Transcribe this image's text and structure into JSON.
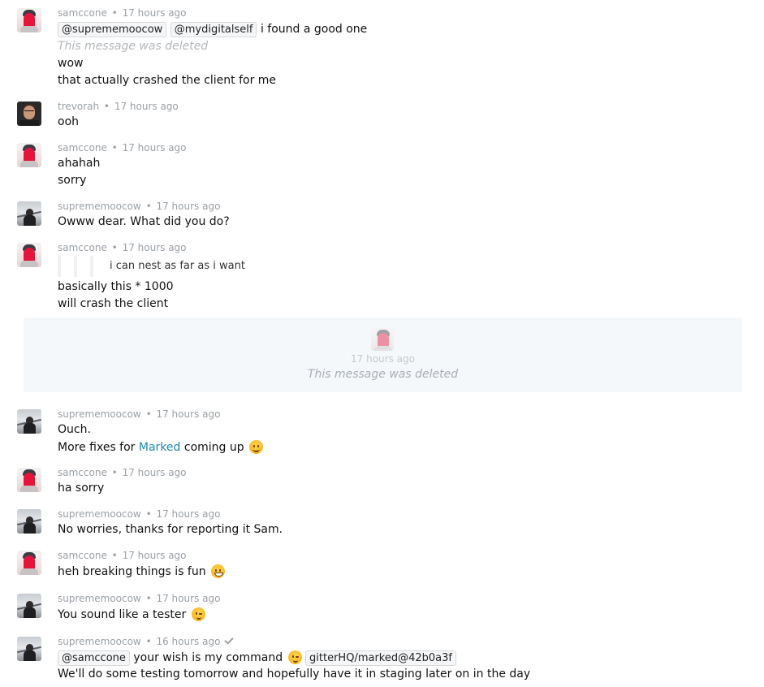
{
  "sep": "•",
  "messages": {
    "m1": {
      "user": "samccone",
      "time": "17 hours ago",
      "mention1": "@suprememoocow",
      "mention2": "@mydigitalself",
      "text1": "i found a good one",
      "deleted": "This message was deleted",
      "text2": "wow",
      "text3": "that actually crashed the client for me"
    },
    "m2": {
      "user": "trevorah",
      "time": "17 hours ago",
      "text1": "ooh"
    },
    "m3": {
      "user": "samccone",
      "time": "17 hours ago",
      "text1": "ahahah",
      "text2": "sorry"
    },
    "m4": {
      "user": "suprememoocow",
      "time": "17 hours ago",
      "text1": "Owww dear. What did you do?"
    },
    "m5": {
      "user": "samccone",
      "time": "17 hours ago",
      "quote": "i can nest as far as i want",
      "text1": "basically this * 1000",
      "text2": "will crash the client"
    },
    "m6": {
      "time": "17 hours ago",
      "deleted": "This message was deleted"
    },
    "m7": {
      "user": "suprememoocow",
      "time": "17 hours ago",
      "text1": "Ouch.",
      "text2_pre": "More fixes for",
      "text2_link": "Marked",
      "text2_post": "coming up"
    },
    "m8": {
      "user": "samccone",
      "time": "17 hours ago",
      "text1": "ha sorry"
    },
    "m9": {
      "user": "suprememoocow",
      "time": "17 hours ago",
      "text1": "No worries, thanks for reporting it Sam."
    },
    "m10": {
      "user": "samccone",
      "time": "17 hours ago",
      "text1": "heh breaking things is fun"
    },
    "m11": {
      "user": "suprememoocow",
      "time": "17 hours ago",
      "text1": "You sound like a tester"
    },
    "m12": {
      "user": "suprememoocow",
      "time": "16 hours ago",
      "mention": "@samccone",
      "text1": "your wish is my command",
      "commit": "gitterHQ/marked@42b0a3f",
      "text2": "We'll do some testing tomorrow and hopefully have it in staging later on in the day"
    }
  }
}
